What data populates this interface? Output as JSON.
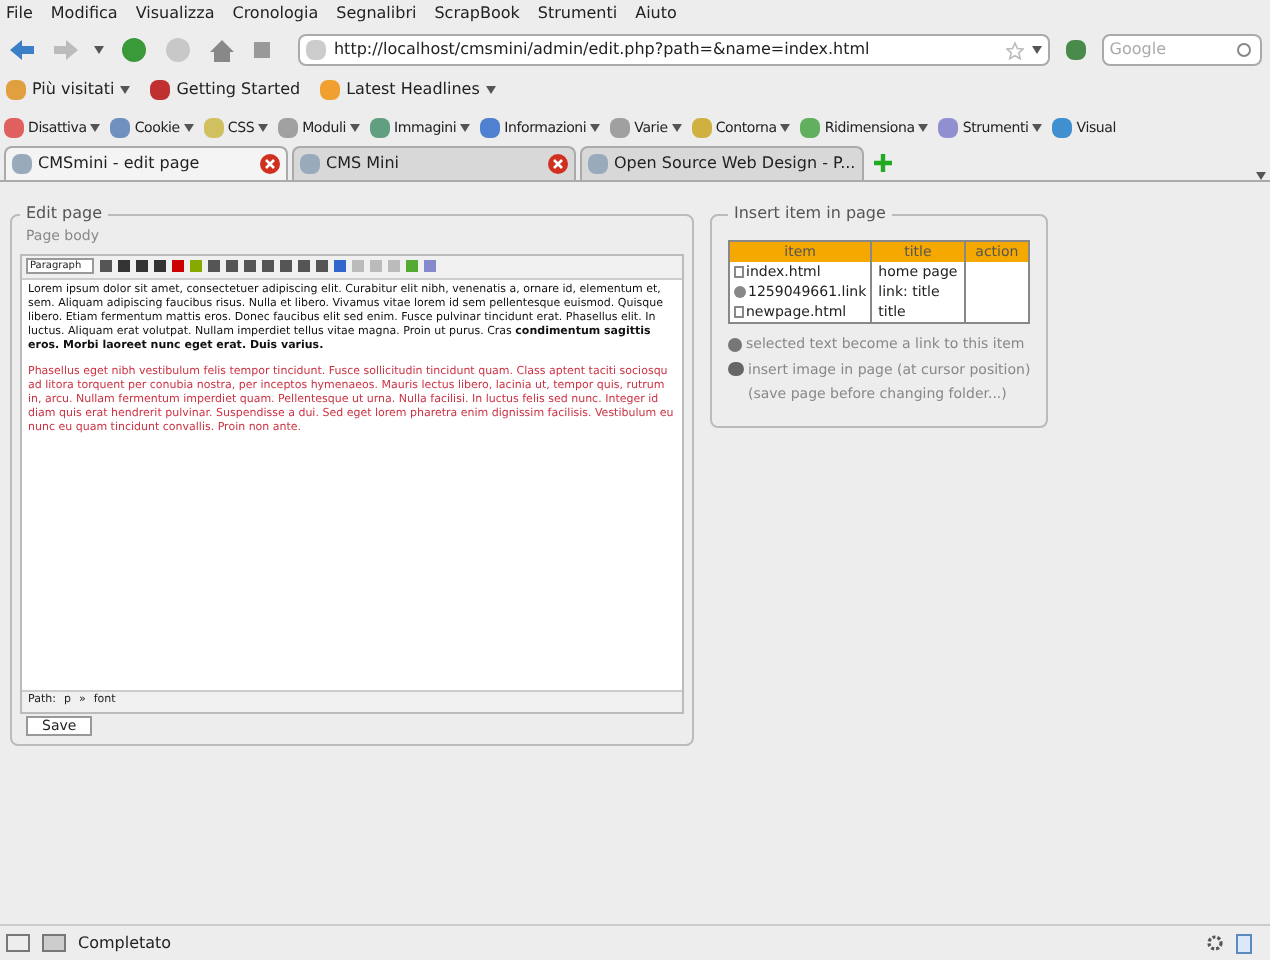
{
  "menu_bar": [
    "File",
    "Modifica",
    "Visualizza",
    "Cronologia",
    "Segnalibri",
    "ScrapBook",
    "Strumenti",
    "Aiuto"
  ],
  "address_bar": {
    "value": "http://localhost/cmsmini/admin/edit.php?path=&name=index.html"
  },
  "search": {
    "placeholder": "Google"
  },
  "bookmarks": [
    {
      "label": "Più visitati",
      "dropdown": true
    },
    {
      "label": "Getting Started",
      "dropdown": false
    },
    {
      "label": "Latest Headlines",
      "dropdown": true
    }
  ],
  "dev_toolbar": [
    "Disattiva",
    "Cookie",
    "CSS",
    "Moduli",
    "Immagini",
    "Informazioni",
    "Varie",
    "Contorna",
    "Ridimensiona",
    "Strumenti",
    "Visual"
  ],
  "tabs": [
    {
      "label": "CMSmini - edit page",
      "selected": true
    },
    {
      "label": "CMS Mini",
      "selected": false
    },
    {
      "label": "Open Source Web Design - P...",
      "selected": false
    }
  ],
  "edit_page": {
    "legend": "Edit page",
    "label": "Page body",
    "format_select": "Paragraph",
    "paragraphs": [
      {
        "text": "Lorem ipsum dolor sit amet, consectetuer adipiscing elit. Curabitur elit nibh, venenatis a, ornare id, elementum et, sem. Aliquam adipiscing faucibus risus. Nulla et libero. Vivamus vitae lorem id sem pellentesque euismod. Quisque libero. Etiam fermentum mattis eros. Donec faucibus elit sed enim. Fusce pulvinar tincidunt erat. Phasellus elit. In luctus. Aliquam erat volutpat. Nullam imperdiet tellus vitae magna. Proin ut purus. Cras **condimentum sagittis eros. Morbi laoreet nunc eget erat. Duis varius.**",
        "color": "#111111"
      },
      {
        "text": "Phasellus eget nibh vestibulum felis tempor tincidunt. Fusce sollicitudin tincidunt quam. Class aptent taciti sociosqu ad litora torquent per conubia nostra, per inceptos hymenaeos. Mauris lectus libero, lacinia ut, tempor quis, rutrum in, arcu. Nullam fermentum imperdiet quam. Pellentesque ut urna. Nulla facilisi. In luctus felis sed nunc. Integer id diam quis erat hendrerit pulvinar. Suspendisse a dui. Sed eget lorem pharetra enim dignissim facilisis. Vestibulum eu nunc eu quam tincidunt convallis. Proin non ante.",
        "color": "#cc3344"
      }
    ],
    "path_label": "Path:",
    "path": [
      "p",
      "font"
    ],
    "path_separator": "»",
    "save_button": "Save"
  },
  "insert_panel": {
    "legend": "Insert item in page",
    "columns": [
      "item",
      "title",
      "action"
    ],
    "rows": [
      {
        "kind": "page",
        "item": "index.html",
        "title": "home page"
      },
      {
        "kind": "link",
        "item": "1259049661.link",
        "title": "link: title"
      },
      {
        "kind": "page",
        "item": "newpage.html",
        "title": "title"
      }
    ],
    "notes": [
      {
        "kind": "link",
        "text": "selected text become a link to this item"
      },
      {
        "kind": "image",
        "text": "insert image in page (at cursor position)"
      },
      {
        "kind": "plain",
        "text": "(save page before changing folder...)"
      }
    ]
  },
  "status_bar": {
    "text": "Completato"
  }
}
